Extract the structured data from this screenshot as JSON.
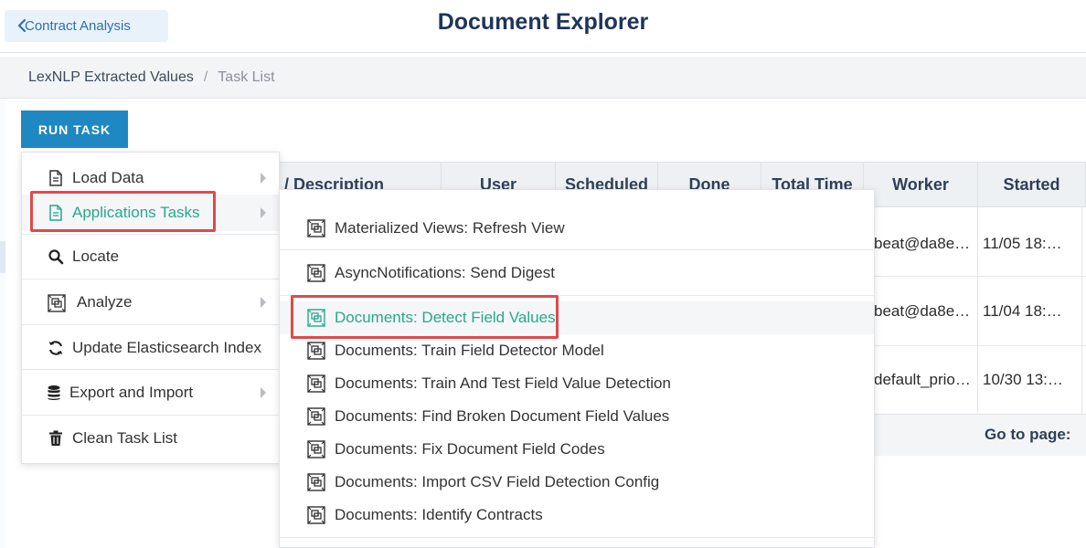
{
  "header": {
    "back_label": "Contract Analysis",
    "title": "Document Explorer"
  },
  "breadcrumb": {
    "link": "LexNLP Extracted Values",
    "separator": "/",
    "current": "Task List"
  },
  "toolbar": {
    "run_task_label": "RUN TASK"
  },
  "table": {
    "columns": [
      "/ Description",
      "User",
      "Scheduled",
      "Done",
      "Total Time",
      "Worker",
      "Started"
    ],
    "rows": [
      {
        "worker": "beat@da8e…",
        "started": "11/05 18:…"
      },
      {
        "worker": "beat@da8e…",
        "started": "11/04 18:…"
      },
      {
        "worker": "default_prio…",
        "started": "10/30 13:…"
      }
    ],
    "goto_label": "Go to page:"
  },
  "menu": {
    "items": [
      {
        "label": "Load Data",
        "icon": "document-icon",
        "has_submenu": true
      },
      {
        "label": "Applications Tasks",
        "icon": "document-icon",
        "has_submenu": true,
        "active": true
      },
      {
        "label": "Locate",
        "icon": "search-icon",
        "has_submenu": false
      },
      {
        "label": "Analyze",
        "icon": "analyze-icon",
        "has_submenu": true
      },
      {
        "label": "Update Elasticsearch Index",
        "icon": "refresh-icon",
        "has_submenu": false
      },
      {
        "label": "Export and Import",
        "icon": "database-icon",
        "has_submenu": true
      },
      {
        "label": "Clean Task List",
        "icon": "trash-icon",
        "has_submenu": false
      }
    ]
  },
  "submenu": {
    "items": [
      {
        "label": "Materialized Views: Refresh View"
      },
      {
        "label": "AsyncNotifications: Send Digest"
      },
      {
        "label": "Documents: Detect Field Values",
        "hover": true
      },
      {
        "label": "Documents: Train Field Detector Model"
      },
      {
        "label": "Documents: Train And Test Field Value Detection"
      },
      {
        "label": "Documents: Find Broken Document Field Values"
      },
      {
        "label": "Documents: Fix Document Field Codes"
      },
      {
        "label": "Documents: Import CSV Field Detection Config"
      },
      {
        "label": "Documents: Identify Contracts"
      }
    ]
  },
  "colors": {
    "accent_green": "#27a98a",
    "primary_blue": "#1f88c2",
    "title_navy": "#1d3559",
    "highlight_red": "#e0494a"
  }
}
